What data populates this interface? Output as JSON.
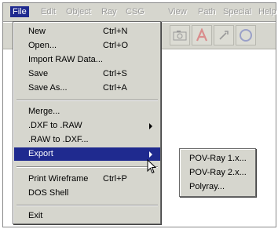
{
  "menubar": {
    "items": [
      {
        "label": "File",
        "active": true
      },
      {
        "label": "Edit"
      },
      {
        "label": "Object"
      },
      {
        "label": "Ray"
      },
      {
        "label": "CSG"
      },
      {
        "label": "View"
      },
      {
        "label": "Path"
      },
      {
        "label": "Special"
      },
      {
        "label": "Help"
      }
    ]
  },
  "toolbar": {
    "icons": [
      "camera-icon",
      "text-a-icon",
      "cursor-tool-icon",
      "sphere-icon"
    ]
  },
  "file_menu": {
    "items": [
      {
        "label": "New",
        "shortcut": "Ctrl+N"
      },
      {
        "label": "Open...",
        "shortcut": "Ctrl+O"
      },
      {
        "label": "Import RAW Data..."
      },
      {
        "label": "Save",
        "shortcut": "Ctrl+S"
      },
      {
        "label": "Save As...",
        "shortcut": "Ctrl+A"
      },
      {
        "label": "Merge..."
      },
      {
        "label": ".DXF to .RAW",
        "submenu": true
      },
      {
        "label": ".RAW to .DXF..."
      },
      {
        "label": "Export",
        "submenu": true,
        "highlighted": true
      },
      {
        "label": "Print Wireframe",
        "shortcut": "Ctrl+P"
      },
      {
        "label": "DOS Shell"
      },
      {
        "label": "Exit"
      }
    ]
  },
  "export_submenu": {
    "items": [
      {
        "label": "POV-Ray 1.x..."
      },
      {
        "label": "POV-Ray 2.x..."
      },
      {
        "label": "Polyray..."
      }
    ]
  },
  "colors": {
    "menu_bg": "#d6d6ce",
    "highlight": "#1f2a8f",
    "disabled_text": "#9c9c9c"
  }
}
